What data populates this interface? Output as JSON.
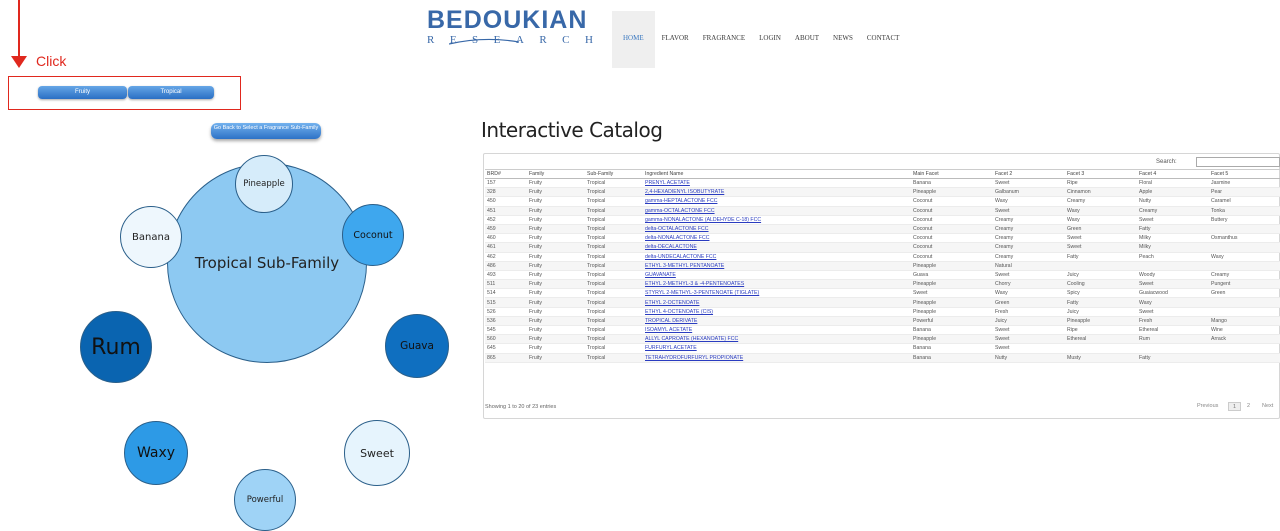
{
  "annotation": {
    "label": "Click",
    "color": "#e0281e"
  },
  "breadcrumb": {
    "items": [
      "Fruity",
      "Tropical"
    ]
  },
  "header": {
    "logo_main": "BEDOUKIAN",
    "logo_sub": "RESEARCH",
    "nav": [
      "HOME",
      "FLAVOR",
      "FRAGRANCE",
      "LOGIN",
      "ABOUT",
      "NEWS",
      "CONTACT"
    ],
    "active_nav": "HOME",
    "brand_color": "#3868a8"
  },
  "bubble_chart": {
    "back_button": "Go Back to Select a Fragrance Sub-Family",
    "center": "Tropical Sub-Family",
    "facets": [
      {
        "label": "Pineapple",
        "color": "#d6ecfa"
      },
      {
        "label": "Coconut",
        "color": "#3ea7ee"
      },
      {
        "label": "Guava",
        "color": "#0f6fc0"
      },
      {
        "label": "Sweet",
        "color": "#e6f4fd"
      },
      {
        "label": "Powerful",
        "color": "#9fd3f6"
      },
      {
        "label": "Waxy",
        "color": "#2d9ae6"
      },
      {
        "label": "Rum",
        "color": "#0a64b0"
      },
      {
        "label": "Banana",
        "color": "#eef7fd"
      }
    ],
    "center_color": "#8dc9f2"
  },
  "catalog": {
    "title": "Interactive Catalog",
    "search_label": "Search:",
    "search_value": "",
    "columns": [
      "BRD#",
      "Family",
      "Sub-Family",
      "Ingredient Name",
      "Main Facet",
      "Facet 2",
      "Facet 3",
      "Facet 4",
      "Facet 5"
    ],
    "rows": [
      [
        "157",
        "Fruity",
        "Tropical",
        "PRENYL ACETATE",
        "Banana",
        "Sweet",
        "Ripe",
        "Floral",
        "Jasmine"
      ],
      [
        "328",
        "Fruity",
        "Tropical",
        "2,4-HEXADIENYL ISOBUTYRATE",
        "Pineapple",
        "Galbanum",
        "Cinnamon",
        "Apple",
        "Pear"
      ],
      [
        "450",
        "Fruity",
        "Tropical",
        "gamma-HEPTALACTONE FCC",
        "Coconut",
        "Waxy",
        "Creamy",
        "Nutty",
        "Caramel"
      ],
      [
        "451",
        "Fruity",
        "Tropical",
        "gamma-OCTALACTONE FCC",
        "Coconut",
        "Sweet",
        "Waxy",
        "Creamy",
        "Tonka"
      ],
      [
        "452",
        "Fruity",
        "Tropical",
        "gamma-NONALACTONE (ALDEHYDE C-18) FCC",
        "Coconut",
        "Creamy",
        "Waxy",
        "Sweet",
        "Buttery"
      ],
      [
        "459",
        "Fruity",
        "Tropical",
        "delta-OCTALACTONE FCC",
        "Coconut",
        "Creamy",
        "Green",
        "Fatty",
        ""
      ],
      [
        "460",
        "Fruity",
        "Tropical",
        "delta-NONALACTONE FCC",
        "Coconut",
        "Creamy",
        "Sweet",
        "Milky",
        "Osmanthus"
      ],
      [
        "461",
        "Fruity",
        "Tropical",
        "delta-DECALACTONE",
        "Coconut",
        "Creamy",
        "Sweet",
        "Milky",
        ""
      ],
      [
        "462",
        "Fruity",
        "Tropical",
        "delta-UNDECALACTONE FCC",
        "Coconut",
        "Creamy",
        "Fatty",
        "Peach",
        "Waxy"
      ],
      [
        "486",
        "Fruity",
        "Tropical",
        "ETHYL 3-METHYL PENTANOATE",
        "Pineapple",
        "Natural",
        "",
        "",
        ""
      ],
      [
        "493",
        "Fruity",
        "Tropical",
        "GUAVANATE",
        "Guava",
        "Sweet",
        "Juicy",
        "Woody",
        "Creamy"
      ],
      [
        "511",
        "Fruity",
        "Tropical",
        "ETHYL 2-METHYL-3 & -4-PENTENOATES",
        "Pineapple",
        "Chorry",
        "Cooling",
        "Sweet",
        "Pungent"
      ],
      [
        "514",
        "Fruity",
        "Tropical",
        "STYRYL 2-METHYL-3-PENTENOATE (TIGLATE)",
        "Sweet",
        "Waxy",
        "Spicy",
        "Guaiacwood",
        "Green"
      ],
      [
        "515",
        "Fruity",
        "Tropical",
        "ETHYL 2-OCTENOATE",
        "Pineapple",
        "Green",
        "Fatty",
        "Waxy",
        ""
      ],
      [
        "526",
        "Fruity",
        "Tropical",
        "ETHYL 4-OCTENOATE (CIS)",
        "Pineapple",
        "Fresh",
        "Juicy",
        "Sweet",
        ""
      ],
      [
        "536",
        "Fruity",
        "Tropical",
        "TROPICAL DERIVATE",
        "Powerful",
        "Juicy",
        "Pineapple",
        "Fresh",
        "Mango"
      ],
      [
        "545",
        "Fruity",
        "Tropical",
        "ISOAMYL ACETATE",
        "Banana",
        "Sweet",
        "Ripe",
        "Ethereal",
        "Wine"
      ],
      [
        "560",
        "Fruity",
        "Tropical",
        "ALLYL CAPROATE (HEXANOATE) FCC",
        "Pineapple",
        "Sweet",
        "Ethereal",
        "Rum",
        "Arrack"
      ],
      [
        "645",
        "Fruity",
        "Tropical",
        "FURFURYL ACETATE",
        "Banana",
        "Sweet",
        "",
        "",
        ""
      ],
      [
        "865",
        "Fruity",
        "Tropical",
        "TETRAHYDROFURFURYL PROPIONATE",
        "Banana",
        "Nutty",
        "Musty",
        "Fatty",
        ""
      ]
    ],
    "info": "Showing 1 to 20 of 23 entries",
    "pager": {
      "previous": "Previous",
      "pages": [
        "1",
        "2"
      ],
      "next": "Next"
    }
  }
}
